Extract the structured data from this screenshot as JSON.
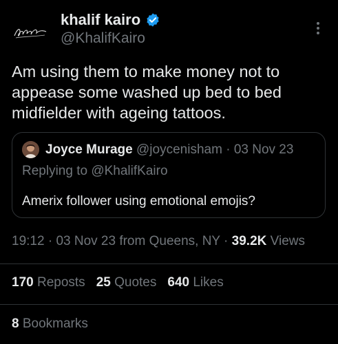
{
  "author": {
    "display_name": "khalif kairo",
    "handle": "@KhalifKairo",
    "avatar_icon": "signature-logo-icon",
    "verified_icon": "verified-badge-icon",
    "verified_color": "#1d9bf0"
  },
  "tweet": {
    "text": "Am using them to make money not to appease some washed up bed to bed midfielder with ageing tattoos."
  },
  "quoted_tweet": {
    "display_name": "Joyce Murage",
    "handle": "@joycenisham",
    "separator": "·",
    "date": "03 Nov 23",
    "replying_to": "Replying to @KhalifKairo",
    "text": "Amerix follower using emotional emojis?"
  },
  "meta": {
    "time": "19:12",
    "separator": "·",
    "date_source": "03 Nov 23 from Queens, NY",
    "views_count": "39.2K",
    "views_label": "Views"
  },
  "stats": {
    "reposts_count": "170",
    "reposts_label": "Reposts",
    "quotes_count": "25",
    "quotes_label": "Quotes",
    "likes_count": "640",
    "likes_label": "Likes",
    "bookmarks_count": "8",
    "bookmarks_label": "Bookmarks"
  },
  "colors": {
    "background": "#000000",
    "text_primary": "#e7e9ea",
    "text_secondary": "#71767b",
    "border": "#2f3336"
  }
}
